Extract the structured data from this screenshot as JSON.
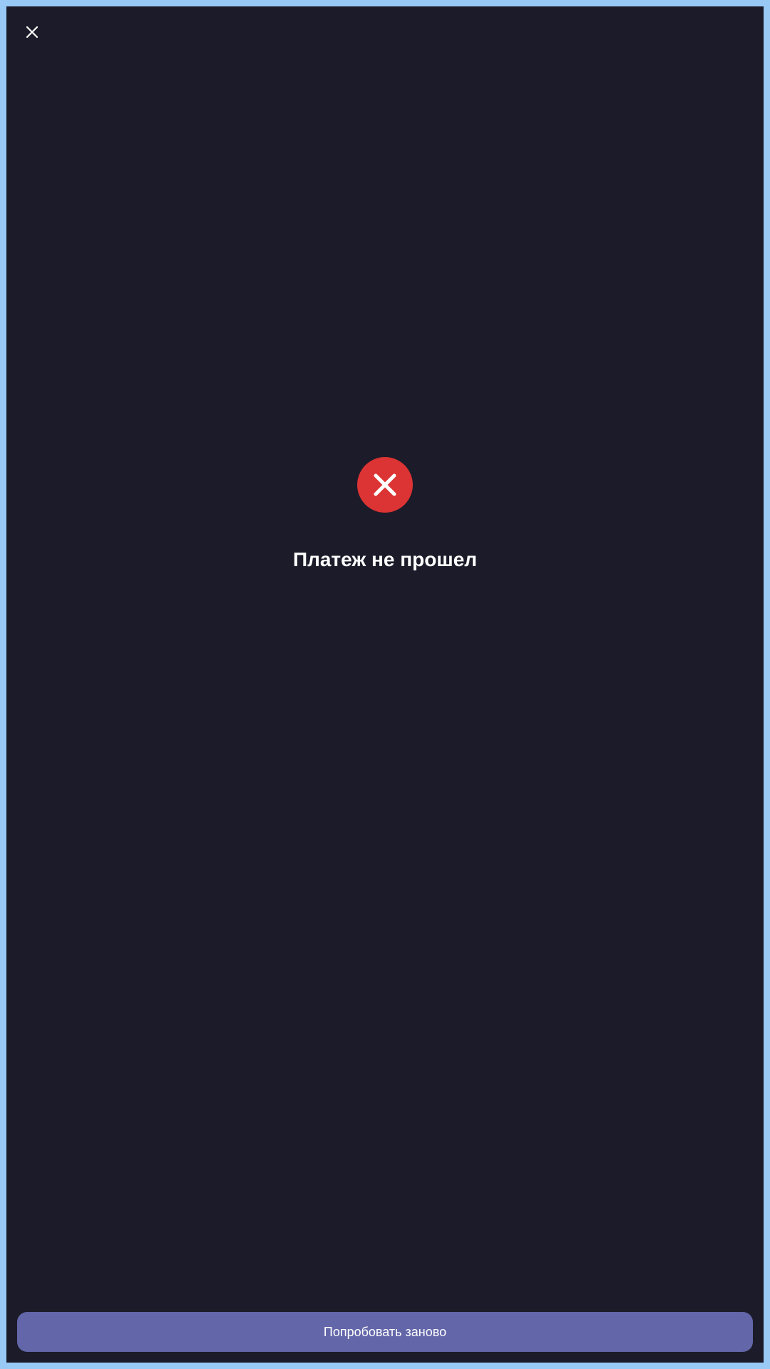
{
  "header": {
    "close_icon": "close-icon"
  },
  "status": {
    "icon": "error-x-icon",
    "color": "#dc3434",
    "title": "Платеж не прошел"
  },
  "actions": {
    "retry_label": "Попробовать заново",
    "retry_color": "#6366a9"
  },
  "theme": {
    "background": "#1c1b29",
    "frame": "#99caf6",
    "text": "#ffffff"
  }
}
